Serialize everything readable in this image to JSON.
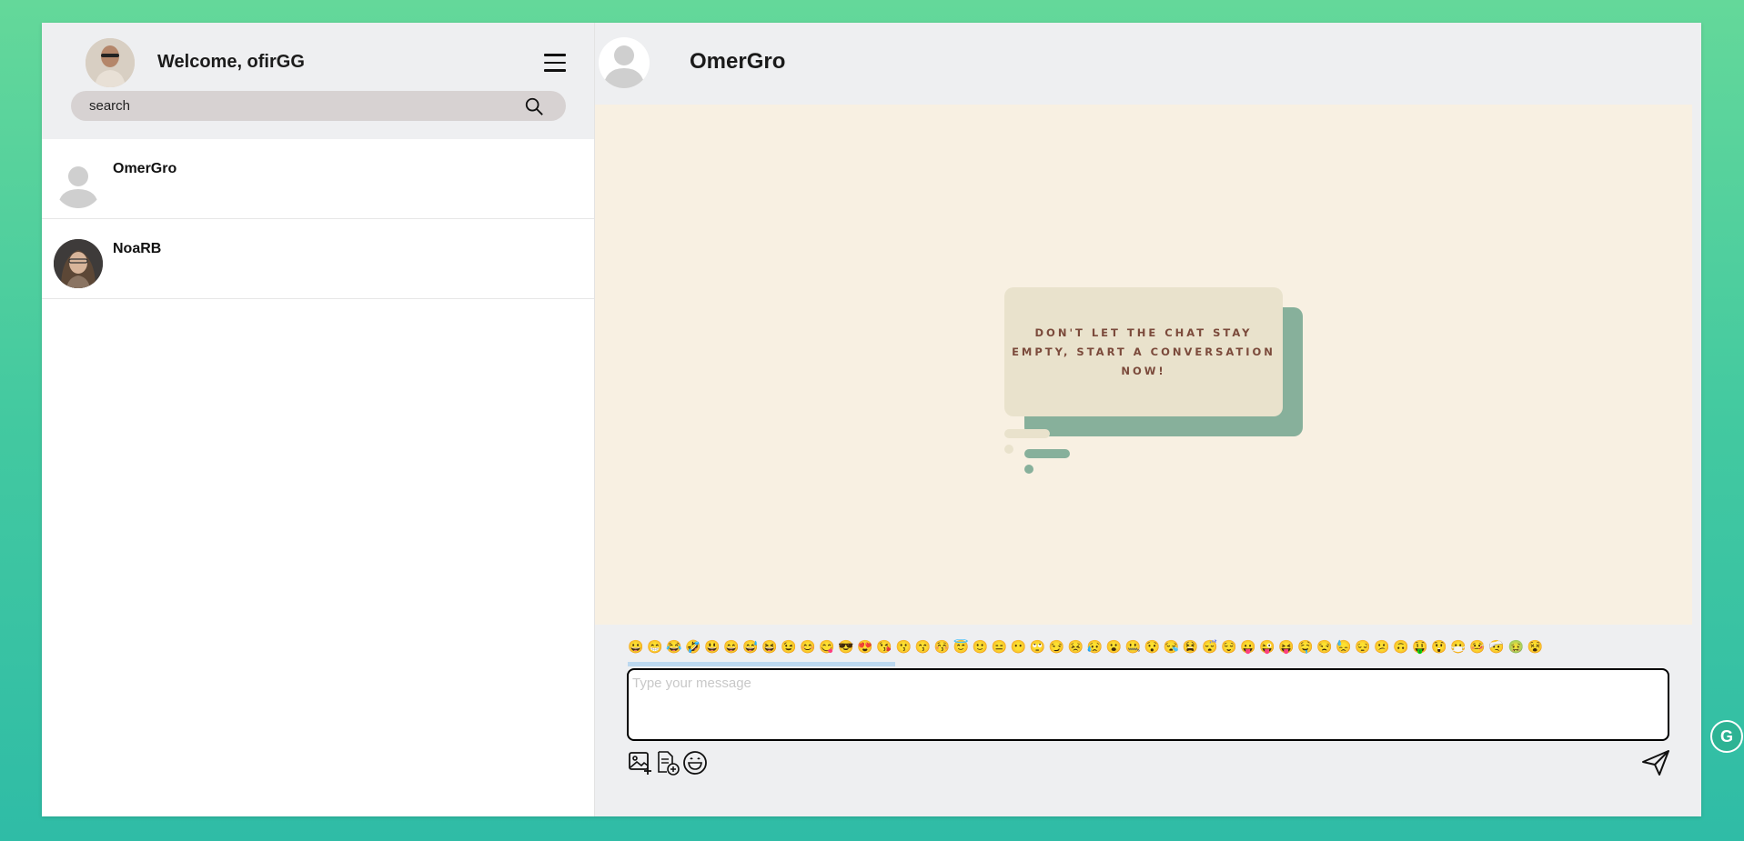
{
  "sidebar": {
    "welcome": "Welcome, ofirGG",
    "search_placeholder": "search",
    "contacts": [
      {
        "name": "OmerGro",
        "avatar": "default-avatar"
      },
      {
        "name": "NoaRB",
        "avatar": "photo-avatar"
      }
    ]
  },
  "chat": {
    "title": "OmerGro",
    "empty_message": "DON'T LET THE CHAT STAY EMPTY, START A CONVERSATION NOW!",
    "input_placeholder": "Type your message",
    "emojis": "😀😁😂🤣😃😄😅😆😉😊😋😎😍😘😗😙😚😇🙂😑😶🙄😏😣😥😮🤐😯😪😫😴😌😛😜😝🤤😒😓😔😕🙃🤑😲😷🤒🤕🤢😵"
  },
  "colors": {
    "accent_green": "#87b09b",
    "chat_bg": "#f8f0e2",
    "panel_bg": "#eeeff1"
  }
}
